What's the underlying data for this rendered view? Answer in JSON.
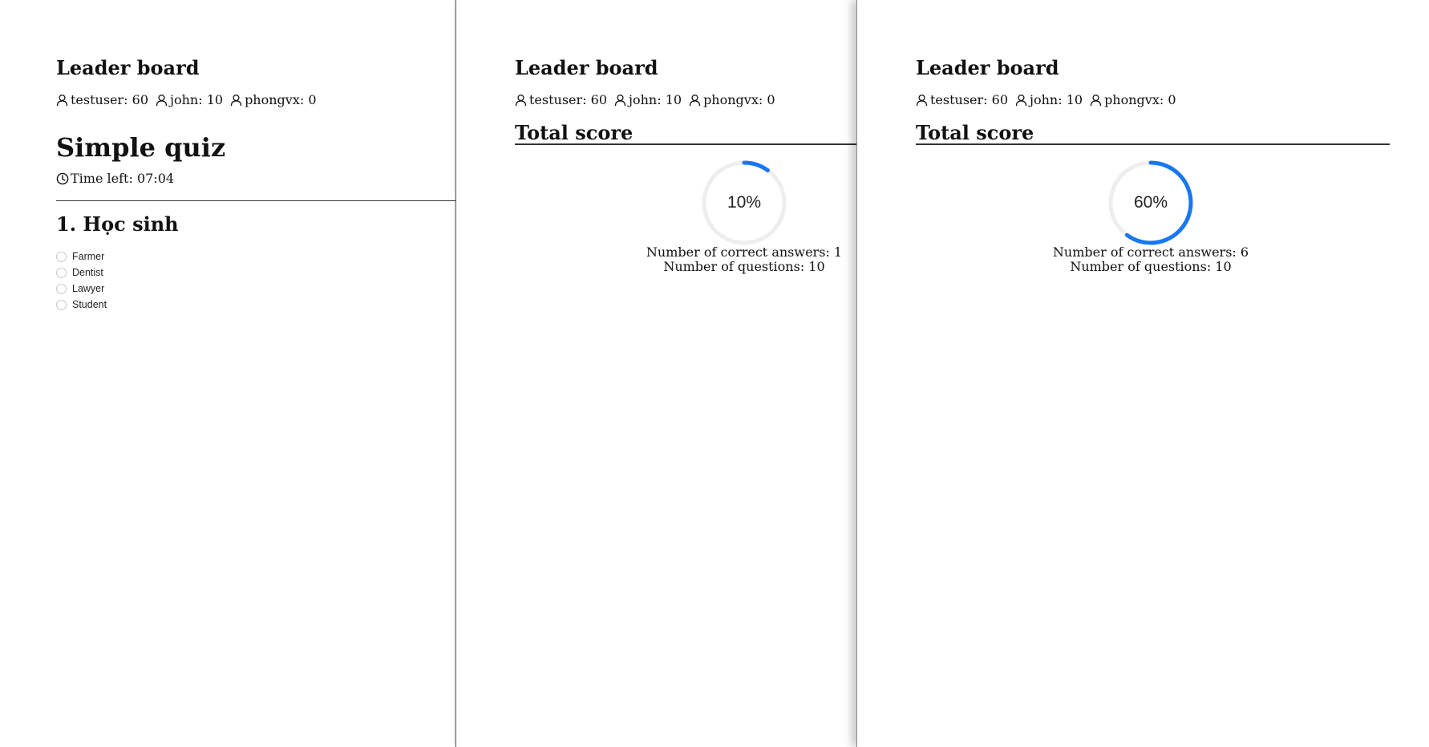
{
  "colors": {
    "accent": "#1877f2",
    "track": "#eeeeee"
  },
  "icons": {
    "leaderboard_user": "user-icon",
    "timer": "clock-icon"
  },
  "panels": [
    {
      "leaderboard": {
        "title": "Leader board",
        "entries": [
          {
            "name": "testuser",
            "score": "60"
          },
          {
            "name": "john",
            "score": "10"
          },
          {
            "name": "phongvx",
            "score": "0"
          }
        ]
      },
      "quiz": {
        "title": "Simple quiz",
        "timer_label": "Time left",
        "timer_value": "07:04",
        "question": {
          "number": "1",
          "text": "Học sinh",
          "options": [
            "Farmer",
            "Dentist",
            "Lawyer",
            "Student"
          ]
        }
      }
    },
    {
      "leaderboard": {
        "title": "Leader board",
        "entries": [
          {
            "name": "testuser",
            "score": "60"
          },
          {
            "name": "john",
            "score": "10"
          },
          {
            "name": "phongvx",
            "score": "0"
          }
        ]
      },
      "total_score": {
        "title": "Total score",
        "percent": 10,
        "correct_label": "Number of correct answers",
        "correct_value": "1",
        "questions_label": "Number of questions",
        "questions_value": "10"
      }
    },
    {
      "leaderboard": {
        "title": "Leader board",
        "entries": [
          {
            "name": "testuser",
            "score": "60"
          },
          {
            "name": "john",
            "score": "10"
          },
          {
            "name": "phongvx",
            "score": "0"
          }
        ]
      },
      "total_score": {
        "title": "Total score",
        "percent": 60,
        "correct_label": "Number of correct answers",
        "correct_value": "6",
        "questions_label": "Number of questions",
        "questions_value": "10"
      }
    }
  ]
}
